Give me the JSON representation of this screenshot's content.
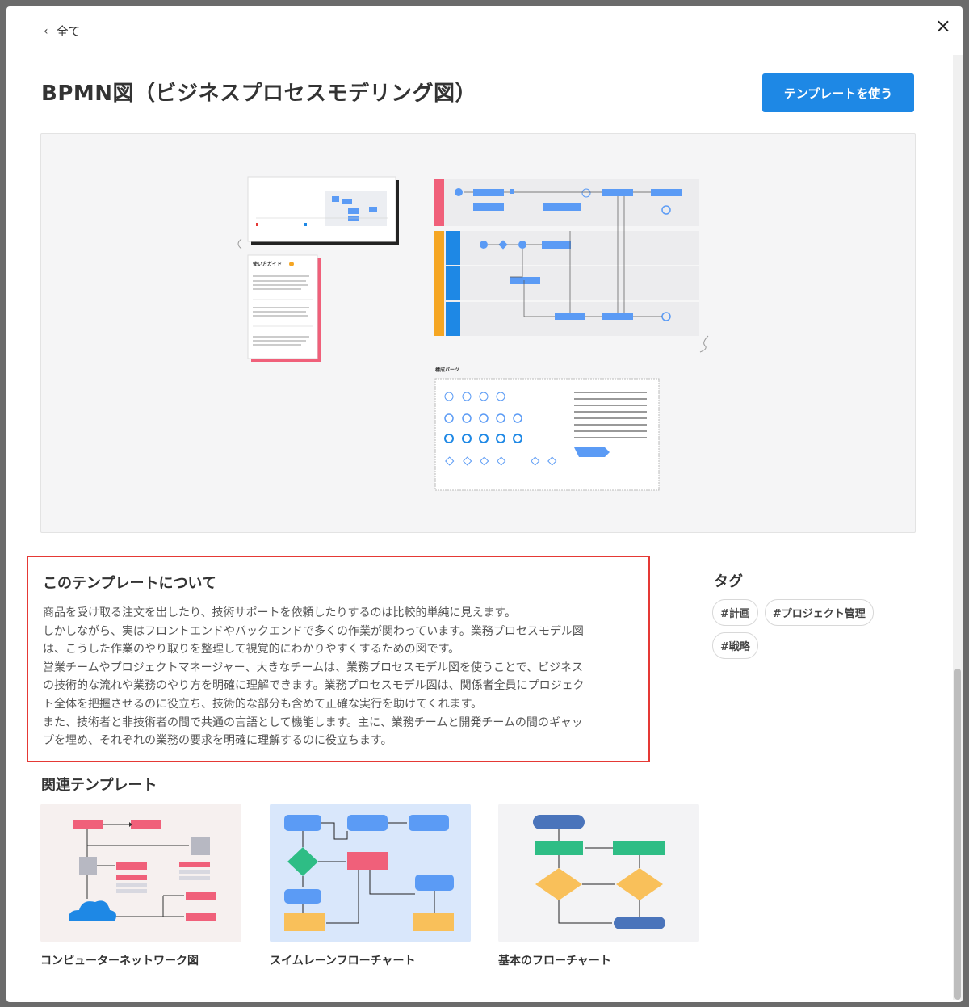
{
  "nav": {
    "back_label": "全て",
    "close_label": "×"
  },
  "header": {
    "title": "BPMN図（ビジネスプロセスモデリング図）",
    "use_button": "テンプレートを使う"
  },
  "preview": {
    "guide_title": "使い方ガイド",
    "parts_title": "構成パーツ"
  },
  "about": {
    "heading": "このテンプレートについて",
    "lines": [
      "商品を受け取る注文を出したり、技術サポートを依頼したりするのは比較的単純に見えます。",
      "しかしながら、実はフロントエンドやバックエンドで多くの作業が関わっています。業務プロセスモデル図",
      "は、こうした作業のやり取りを整理して視覚的にわかりやすくするための図です。",
      "営業チームやプロジェクトマネージャー、大きなチームは、業務プロセスモデル図を使うことで、ビジネス",
      "の技術的な流れや業務のやり方を明確に理解できます。業務プロセスモデル図は、関係者全員にプロジェク",
      "ト全体を把握させるのに役立ち、技術的な部分も含めて正確な実行を助けてくれます。",
      "また、技術者と非技術者の間で共通の言語として機能します。主に、業務チームと開発チームの間のギャッ",
      "プを埋め、それぞれの業務の要求を明確に理解するのに役立ちます。"
    ]
  },
  "tags": {
    "title": "タグ",
    "items": [
      "#計画",
      "#プロジェクト管理",
      "#戦略"
    ]
  },
  "related": {
    "title": "関連テンプレート",
    "cards": [
      {
        "label": "コンピューターネットワーク図"
      },
      {
        "label": "スイムレーンフローチャート"
      },
      {
        "label": "基本のフローチャート"
      }
    ]
  },
  "colors": {
    "accent": "#1e88e5",
    "highlight": "#e53935",
    "pink": "#f0607a",
    "orange": "#f5a623",
    "blue": "#5b9bf5",
    "green": "#2ebd85",
    "yellow": "#f9c05a",
    "navy": "#4a74bb"
  }
}
